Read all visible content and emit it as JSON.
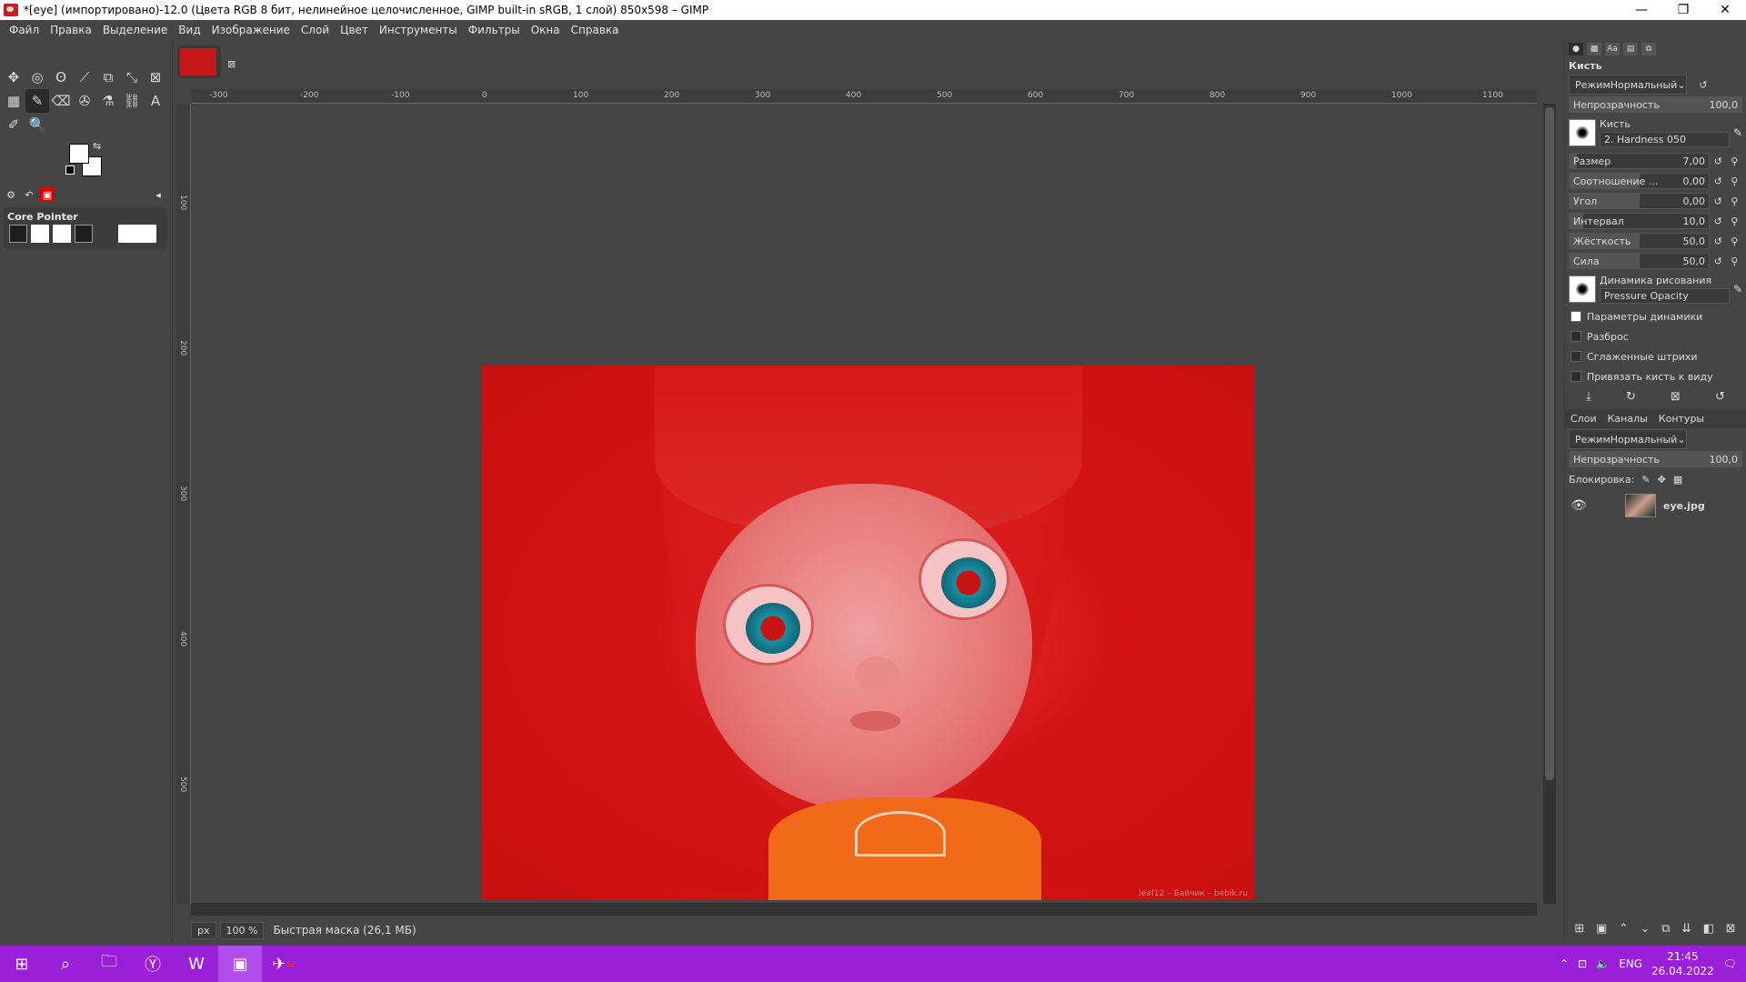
{
  "window": {
    "title": "*[eye] (импортировано)-12.0 (Цвета RGB 8 бит, нелинейное целочисленное, GIMP built-in sRGB, 1 слой) 850x598 – GIMP",
    "minimize": "—",
    "maximize": "❐",
    "close": "✕"
  },
  "menu": [
    "Файл",
    "Правка",
    "Выделение",
    "Вид",
    "Изображение",
    "Слой",
    "Цвет",
    "Инструменты",
    "Фильтры",
    "Окна",
    "Справка"
  ],
  "toolbox": {
    "device": "Core Pointer",
    "tools": [
      "✥",
      "◎",
      "ʘ",
      "⟋",
      "⧉",
      "⤡",
      "⊠",
      "▦",
      "✎",
      "⌫",
      "✇",
      "⚗",
      "⛓",
      "A",
      "✐",
      "🔍"
    ]
  },
  "canvas": {
    "rulers_h": [
      "-300",
      "-200",
      "-100",
      "0",
      "100",
      "200",
      "300",
      "400",
      "500",
      "600",
      "700",
      "800",
      "900",
      "1000",
      "1100"
    ],
    "rulers_v": [
      "100",
      "200",
      "300",
      "400",
      "500"
    ],
    "unit": "px",
    "zoom": "100 %",
    "status": "Быстрая маска (26,1 МБ)",
    "watermark": "leaf12 – Байчик – bebik.ru"
  },
  "brush_panel": {
    "title": "Кисть",
    "mode_label": "Режим",
    "mode_value": "Нормальный",
    "opacity_label": "Непрозрачность",
    "opacity_value": "100,0",
    "brush_label": "Кисть",
    "brush_name": "2. Hardness 050",
    "sliders": [
      {
        "label": "Размер",
        "value": "7,00",
        "fill": 0.05
      },
      {
        "label": "Соотношение ...",
        "value": "0,00",
        "fill": 0.5
      },
      {
        "label": "Угол",
        "value": "0,00",
        "fill": 0.5
      },
      {
        "label": "Интервал",
        "value": "10,0",
        "fill": 0.1
      },
      {
        "label": "Жёсткость",
        "value": "50,0",
        "fill": 0.5
      },
      {
        "label": "Сила",
        "value": "50,0",
        "fill": 0.5
      }
    ],
    "dynamics_label": "Динамика рисования",
    "dynamics_value": "Pressure Opacity",
    "options": [
      "Параметры динамики",
      "Разброс",
      "Сглаженные штрихи",
      "Привязать кисть к виду"
    ]
  },
  "layers_panel": {
    "tabs": [
      "Слои",
      "Каналы",
      "Контуры"
    ],
    "mode_label": "Режим",
    "mode_value": "Нормальный",
    "opacity_label": "Непрозрачность",
    "opacity_value": "100,0",
    "lock_label": "Блокировка:",
    "layer_name": "eye.jpg"
  },
  "taskbar": {
    "lang": "ENG",
    "time": "21:45",
    "date": "26.04.2022",
    "telegram_badge": "82"
  },
  "colors": {
    "accent_taskbar": "#9a1fd8",
    "mask_red": "#d41414",
    "ui_bg": "#454545"
  }
}
